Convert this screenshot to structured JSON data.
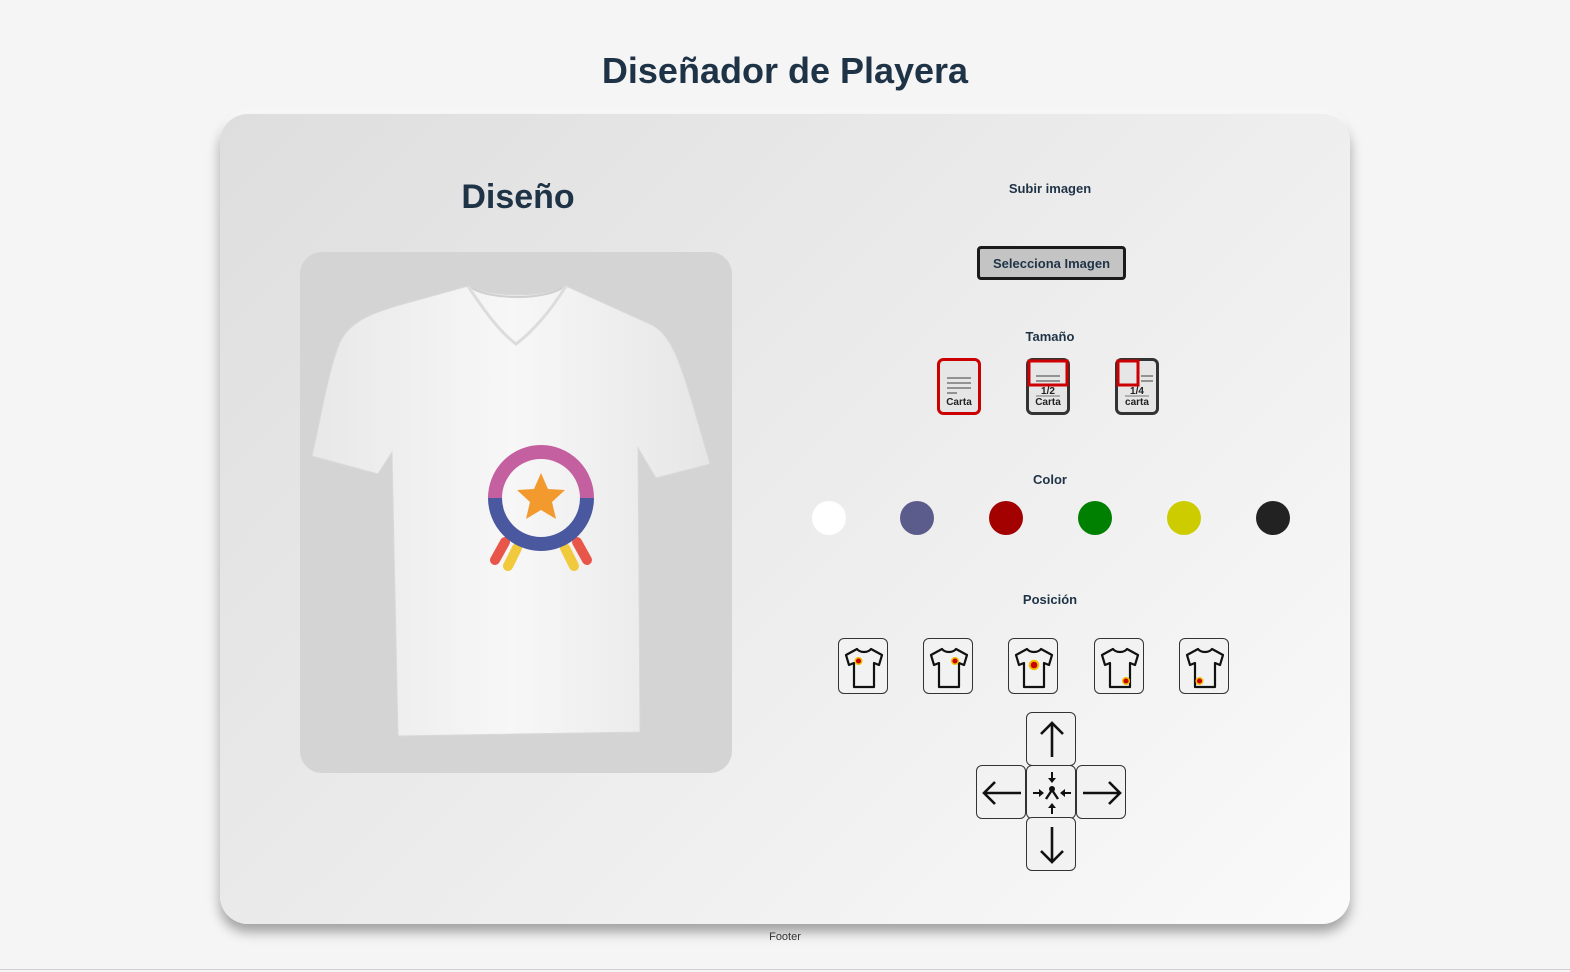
{
  "page": {
    "title": "Diseñador de Playera",
    "footer": "Footer"
  },
  "preview": {
    "title": "Diseño",
    "shirt_color": "#ffffff"
  },
  "controls": {
    "upload": {
      "label": "Subir imagen",
      "button": "Selecciona Imagen"
    },
    "size": {
      "label": "Tamaño",
      "options": [
        {
          "fraction": "",
          "name": "Carta",
          "selected": true
        },
        {
          "fraction": "1/2",
          "name": "Carta",
          "selected": false
        },
        {
          "fraction": "1/4",
          "name": "carta",
          "selected": false
        }
      ]
    },
    "color": {
      "label": "Color",
      "swatches": [
        "#ffffff",
        "#5b5b8c",
        "#a30000",
        "#008000",
        "#cccc00",
        "#222222"
      ]
    },
    "position": {
      "label": "Posición",
      "presets": [
        "left-chest",
        "right-chest",
        "center",
        "bottom-right",
        "bottom-left"
      ]
    },
    "move": {
      "icons": [
        "arrow-up-icon",
        "arrow-left-icon",
        "center-icon",
        "arrow-right-icon",
        "arrow-down-icon"
      ]
    }
  }
}
